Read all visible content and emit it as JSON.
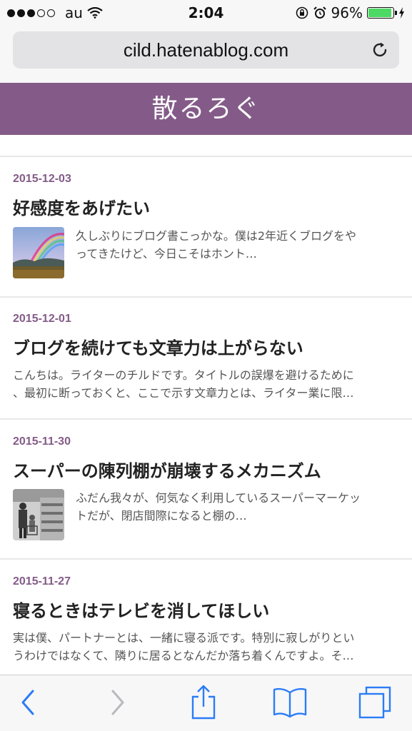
{
  "status_bar": {
    "carrier": "au",
    "time": "2:04",
    "battery_percent": "96%",
    "battery_level": 0.96,
    "signal_filled": 3,
    "signal_total": 5
  },
  "browser": {
    "url": "cild.hatenablog.com"
  },
  "blog": {
    "title": "散るろぐ",
    "header_color": "#845b88"
  },
  "entries": [
    {
      "date": "2015-12-03",
      "title": "好感度をあげたい",
      "excerpt_line1": "久しぶりにブログ書こっかな。僕は2年近くブログをや",
      "excerpt_line2": "ってきたけど、今日こそはホント…",
      "thumbnail": "rainbow-landscape-thumbnail"
    },
    {
      "date": "2015-12-01",
      "title": "ブログを続けても文章力は上がらない",
      "excerpt_line1": "こんちは。ライターのチルドです。タイトルの誤爆を避けるために",
      "excerpt_line2": "、最初に断っておくと、ここで示す文章力とは、ライター業に限…"
    },
    {
      "date": "2015-11-30",
      "title": "スーパーの陳列棚が崩壊するメカニズム",
      "excerpt_line1": "ふだん我々が、何気なく利用しているスーパーマーケッ",
      "excerpt_line2": "トだが、閉店間際になると棚の…",
      "thumbnail": "supermarket-photo-thumbnail"
    },
    {
      "date": "2015-11-27",
      "title": "寝るときはテレビを消してほしい",
      "excerpt_line1": "実は僕、パートナーとは、一緒に寝る派です。特別に寂しがりとい",
      "excerpt_line2": "うわけではなくて、隣りに居るとなんだか落ち着くんですよ。そ…"
    }
  ],
  "toolbar": {
    "icons": [
      "back-icon",
      "forward-icon",
      "share-icon",
      "bookmarks-icon",
      "tabs-icon"
    ],
    "accent": "#2b7cf6"
  }
}
